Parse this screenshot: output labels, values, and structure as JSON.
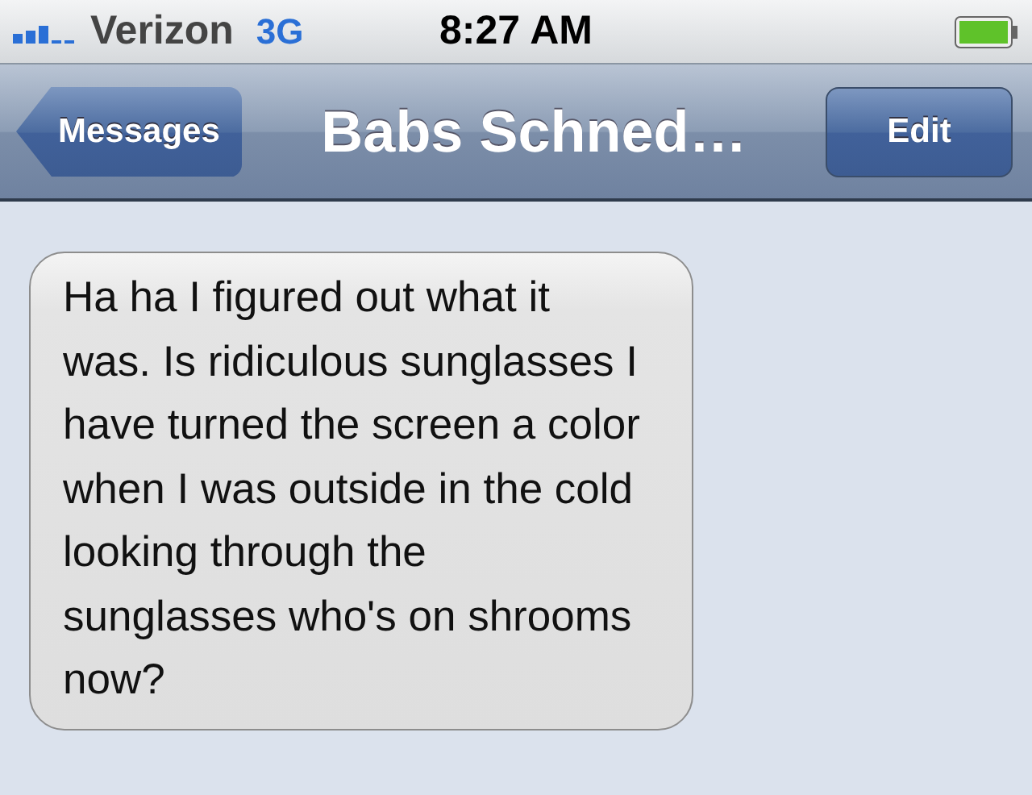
{
  "status_bar": {
    "carrier": "Verizon",
    "network": "3G",
    "time": "8:27 AM"
  },
  "nav_bar": {
    "back": "Messages",
    "title": "Babs Schned…",
    "action": "Edit"
  },
  "messages": [
    {
      "text": "Ha ha I figured out what it was. Is ridiculous sunglasses I have turned the screen a color when I was outside in the cold looking through the sunglasses who's on shrooms now?",
      "kind": "received"
    }
  ]
}
